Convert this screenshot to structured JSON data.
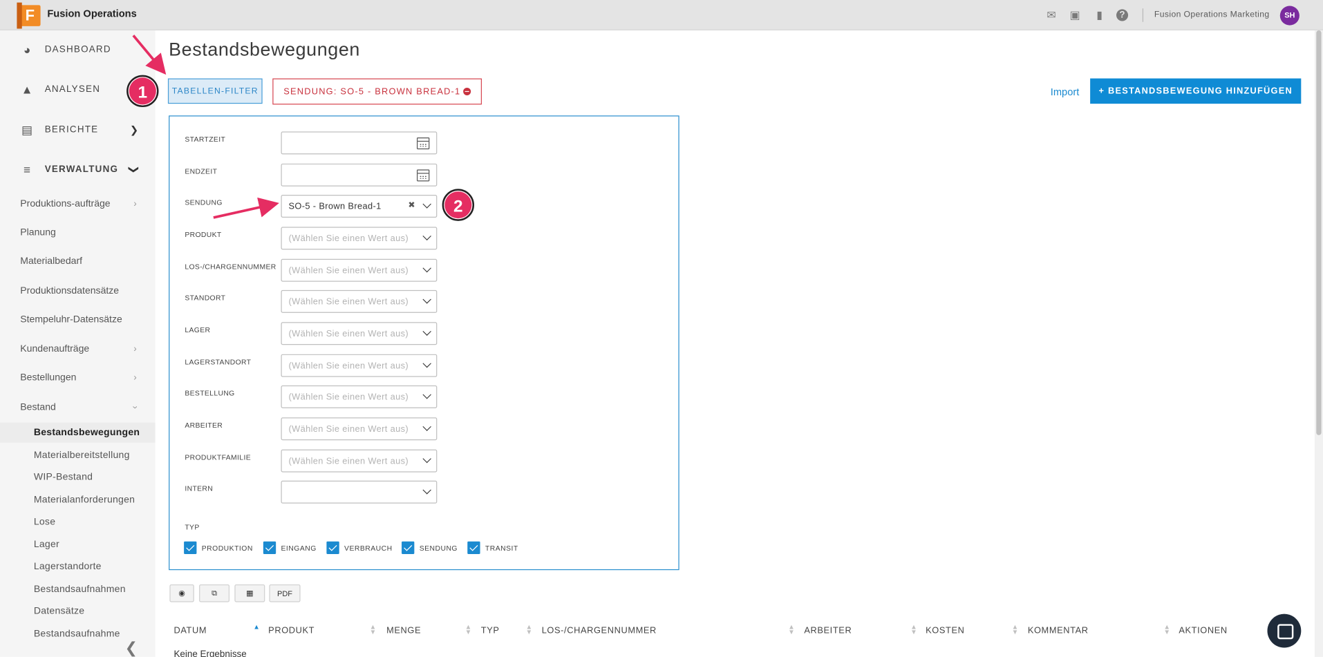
{
  "app": {
    "title": "Fusion Operations",
    "logo_letter": "F",
    "user_label": "Fusion Operations Marketing",
    "avatar_initials": "SH"
  },
  "sidebar": {
    "main": [
      {
        "label": "DASHBOARD",
        "icon": "gauge-icon"
      },
      {
        "label": "ANALYSEN",
        "icon": "chart-icon"
      },
      {
        "label": "BERICHTE",
        "icon": "report-icon"
      },
      {
        "label": "VERWALTUNG",
        "icon": "sliders-icon"
      }
    ],
    "sub": [
      "Produktions-aufträge",
      "Planung",
      "Materialbedarf",
      "Produktionsdatensätze",
      "Stempeluhr-Datensätze",
      "Kundenaufträge",
      "Bestellungen",
      "Bestand"
    ],
    "leaves": [
      "Bestandsbewegungen",
      "Materialbereitstellung",
      "WIP-Bestand",
      "Materialanforderungen",
      "Lose",
      "Lager",
      "Lagerstandorte",
      "Bestandsaufnahmen",
      "Datensätze",
      "Bestandsaufnahme"
    ]
  },
  "main": {
    "title": "Bestandsbewegungen",
    "filter_button": "TABELLEN-FILTER",
    "active_chip": "SENDUNG: SO-5 - BROWN BREAD-1",
    "import_link": "Import",
    "add_button": "+ BESTANDSBEWEGUNG HINZUFÜGEN"
  },
  "filters": {
    "placeholder": "(Wählen Sie einen Wert aus)",
    "fields": [
      {
        "label": "STARTZEIT",
        "value": ""
      },
      {
        "label": "ENDZEIT",
        "value": ""
      },
      {
        "label": "SENDUNG",
        "value": "SO-5 - Brown Bread-1"
      },
      {
        "label": "PRODUKT",
        "value": ""
      },
      {
        "label": "LOS-/CHARGENNUMMER",
        "value": ""
      },
      {
        "label": "STANDORT",
        "value": ""
      },
      {
        "label": "LAGER",
        "value": ""
      },
      {
        "label": "LAGERSTANDORT",
        "value": ""
      },
      {
        "label": "BESTELLUNG",
        "value": ""
      },
      {
        "label": "ARBEITER",
        "value": ""
      },
      {
        "label": "PRODUKTFAMILIE",
        "value": ""
      },
      {
        "label": "INTERN",
        "value": ""
      }
    ],
    "typ_label": "TYP",
    "typ_options": [
      {
        "label": "PRODUKTION",
        "checked": true
      },
      {
        "label": "EINGANG",
        "checked": true
      },
      {
        "label": "VERBRAUCH",
        "checked": true
      },
      {
        "label": "SENDUNG",
        "checked": true
      },
      {
        "label": "TRANSIT",
        "checked": true
      }
    ]
  },
  "toolbar": {
    "pdf_label": "PDF"
  },
  "table": {
    "columns": [
      "DATUM",
      "PRODUKT",
      "MENGE",
      "TYP",
      "LOS-/CHARGENNUMMER",
      "ARBEITER",
      "KOSTEN",
      "KOMMENTAR",
      "AKTIONEN"
    ],
    "empty_text": "Keine Ergebnisse"
  },
  "annotations": {
    "badge1": "1",
    "badge2": "2"
  },
  "colors": {
    "accent": "#0f8bd5",
    "chip_red": "#c8313d",
    "badge": "#e52d62",
    "logo": "#f28c26"
  }
}
